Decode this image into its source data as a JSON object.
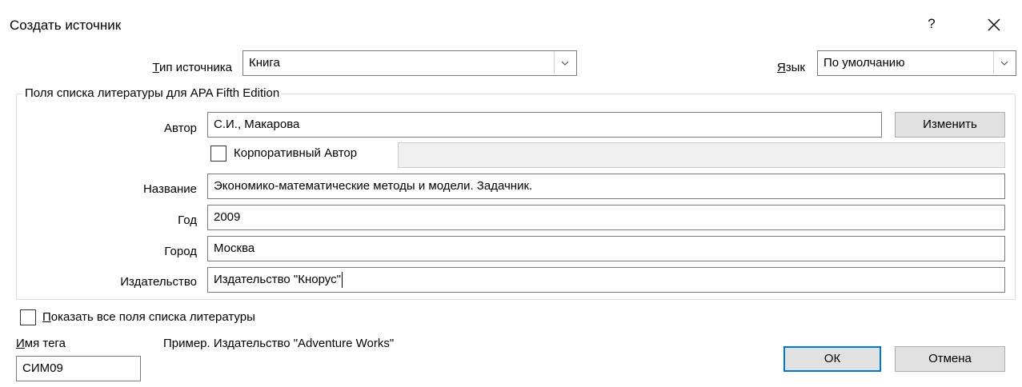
{
  "dialog": {
    "title": "Создать источник",
    "help_label": "?",
    "close_label": "✕"
  },
  "source_type": {
    "label": "Тип источника",
    "value": "Книга"
  },
  "language": {
    "label": "Язык",
    "value": "По умолчанию"
  },
  "group": {
    "title": "Поля списка литературы для APA Fifth Edition",
    "author": {
      "label": "Автор",
      "value": "С.И., Макарова",
      "edit_button": "Изменить"
    },
    "corporate_author": {
      "label": "Корпоративный Автор",
      "checked": false,
      "value": ""
    },
    "title_field": {
      "label": "Название",
      "value": "Экономико-математические методы и модели. Задачник."
    },
    "year": {
      "label": "Год",
      "value": "2009"
    },
    "city": {
      "label": "Город",
      "value": "Москва"
    },
    "publisher": {
      "label": "Издательство",
      "value": "Издательство \"Кнорус\""
    }
  },
  "show_all": {
    "label": "Показать все поля списка литературы",
    "checked": false
  },
  "tag": {
    "label": "Имя тега",
    "value": "СИМ09"
  },
  "example": {
    "text": "Пример. Издательство \"Adventure Works\""
  },
  "buttons": {
    "ok": "ОК",
    "cancel": "Отмена"
  }
}
